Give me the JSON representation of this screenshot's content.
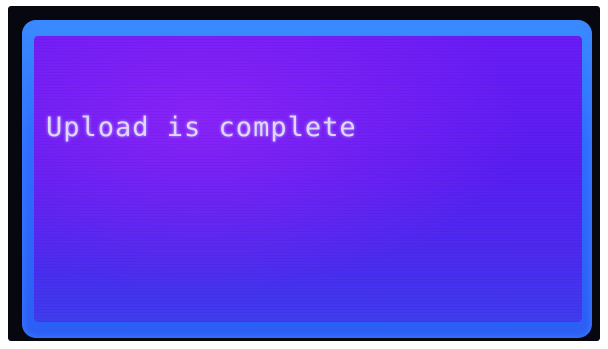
{
  "display": {
    "message": "Upload is complete"
  },
  "colors": {
    "panel": "#5a1ef2",
    "backlight": "#2f6cff",
    "text": "#dcd8ff",
    "bezel": "#07070f"
  }
}
